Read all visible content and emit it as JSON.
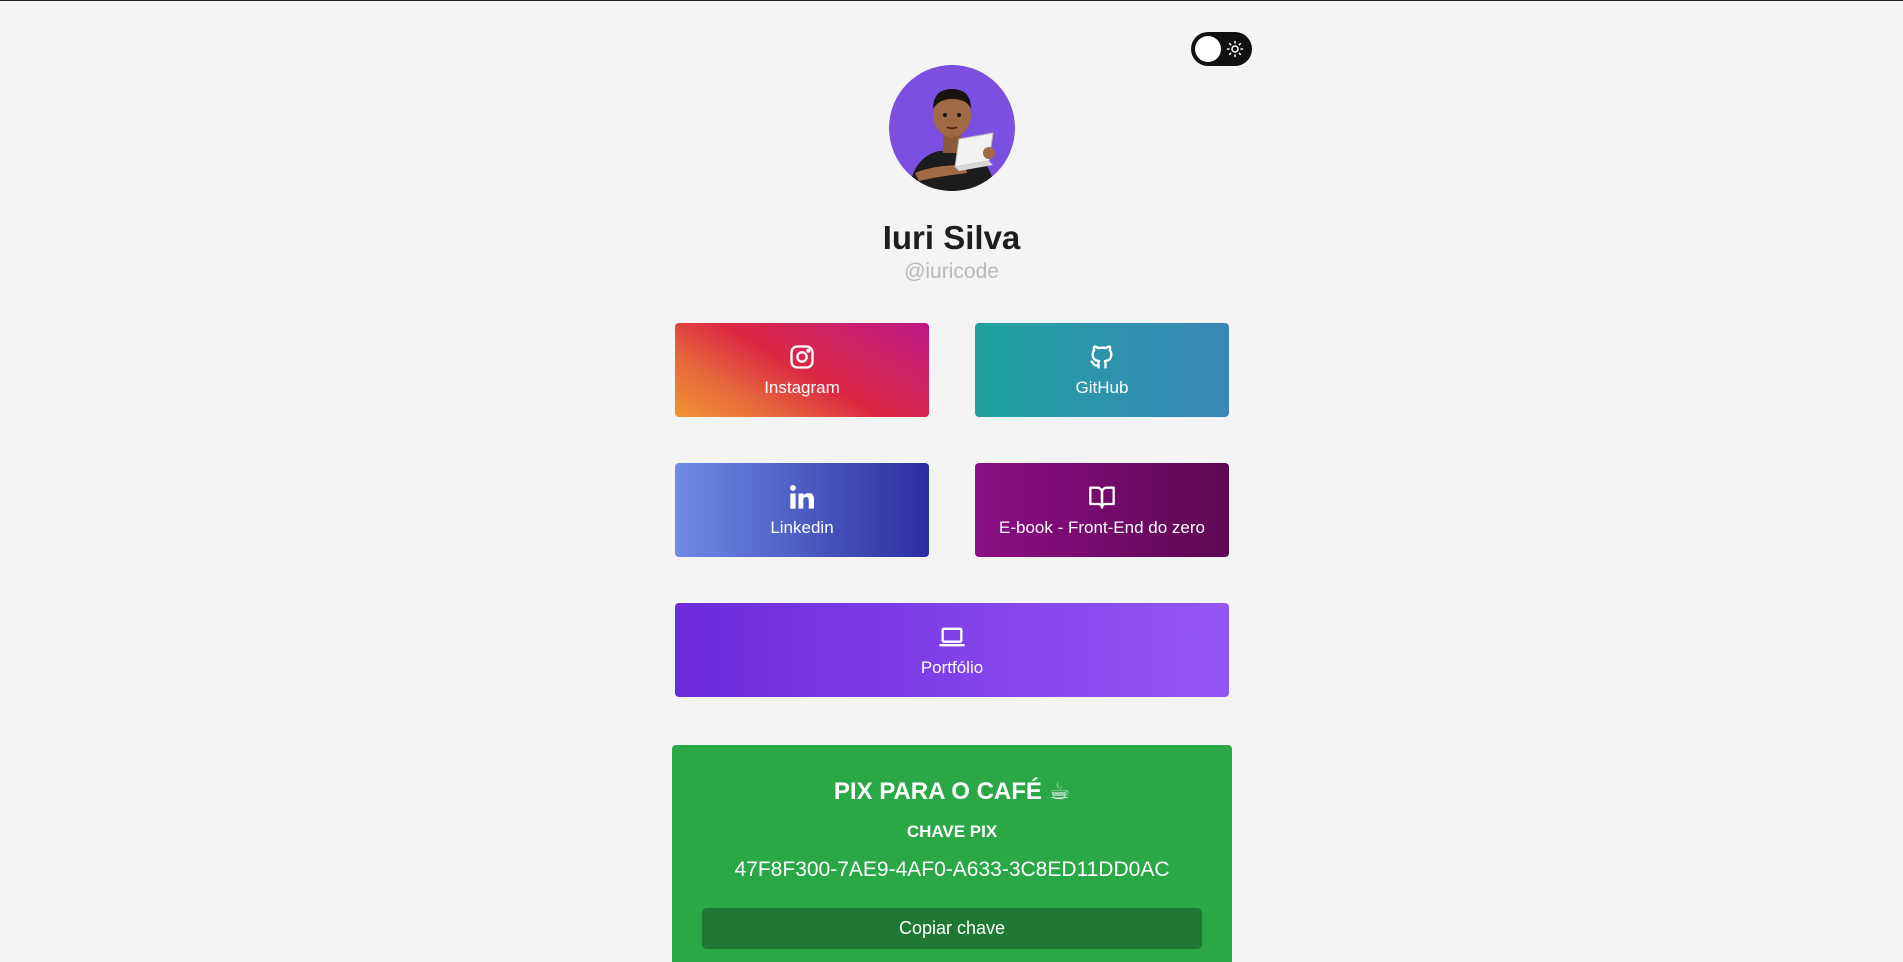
{
  "theme_toggle": {
    "icon": "sun-icon"
  },
  "profile": {
    "name": "Iuri Silva",
    "handle": "@iuricode",
    "avatar_bg": "#7b4fe0"
  },
  "links": [
    {
      "label": "Instagram",
      "icon": "instagram-icon"
    },
    {
      "label": "GitHub",
      "icon": "github-icon"
    },
    {
      "label": "Linkedin",
      "icon": "linkedin-icon"
    },
    {
      "label": "E-book - Front-End do zero",
      "icon": "book-icon"
    },
    {
      "label": "Portfólio",
      "icon": "laptop-icon"
    }
  ],
  "pix": {
    "title": "PIX PARA O CAFÉ ☕",
    "subtitle": "CHAVE PIX",
    "key": "47F8F300-7AE9-4AF0-A633-3C8ED11DD0AC",
    "copy_label": "Copiar chave",
    "bg": "#29a845"
  }
}
